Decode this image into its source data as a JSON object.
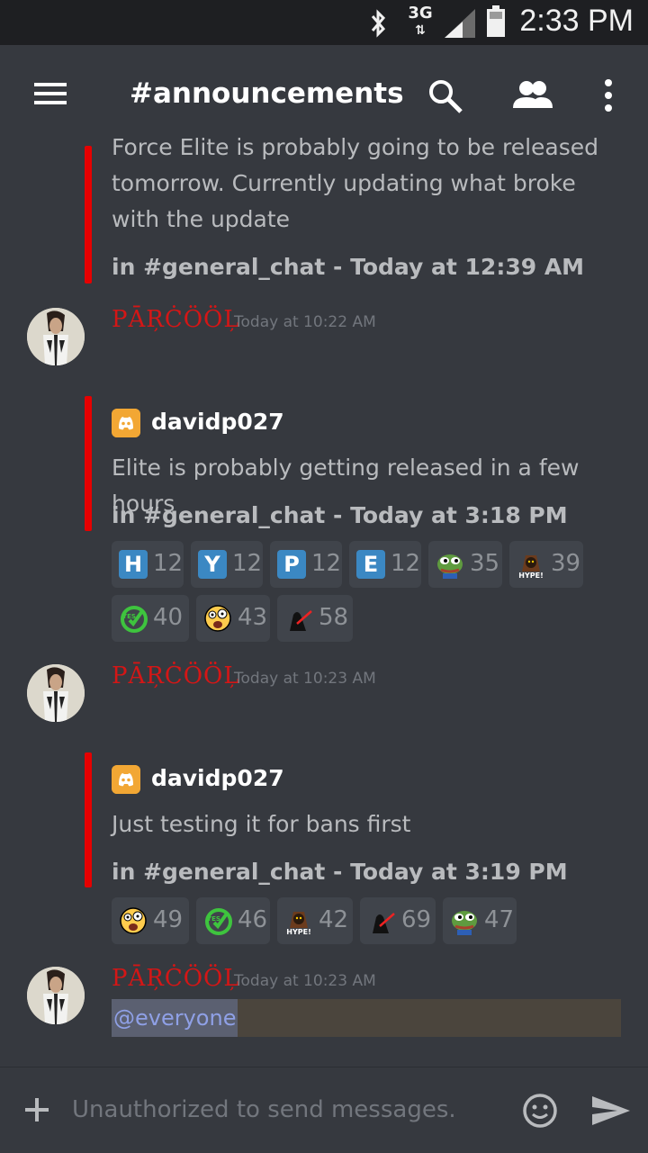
{
  "status_bar": {
    "time": "2:33 PM",
    "network": "3G"
  },
  "header": {
    "title": "#announcements"
  },
  "messages": [
    {
      "type": "embed-only",
      "embed_text": "Force Elite is probably going to be released tomorrow. Currently updating what broke with the update",
      "embed_meta": "in #general_chat - Today at 12:39 AM"
    },
    {
      "author": "PĀŖĊÖÖĻ",
      "timestamp": "Today at 10:22 AM",
      "embed": {
        "author": "davidp027",
        "text": "Elite is probably getting released in a few hours",
        "meta": "in #general_chat - Today at 3:18 PM"
      },
      "reactions": [
        {
          "emoji": "H",
          "kind": "letter",
          "count": "12"
        },
        {
          "emoji": "Y",
          "kind": "letter",
          "count": "12"
        },
        {
          "emoji": "P",
          "kind": "letter",
          "count": "12"
        },
        {
          "emoji": "E",
          "kind": "letter",
          "count": "12"
        },
        {
          "emoji": "pepe-emoji",
          "kind": "pepe",
          "count": "35"
        },
        {
          "emoji": "hype-emoji",
          "kind": "hype",
          "count": "39"
        },
        {
          "emoji": "yes-emoji",
          "kind": "yes",
          "count": "40"
        },
        {
          "emoji": "shocked-face-emoji",
          "kind": "face",
          "count": "43"
        },
        {
          "emoji": "vader-emoji",
          "kind": "vader",
          "count": "58"
        }
      ]
    },
    {
      "author": "PĀŖĊÖÖĻ",
      "timestamp": "Today at 10:23 AM",
      "embed": {
        "author": "davidp027",
        "text": "Just testing it for bans first",
        "meta": "in #general_chat - Today at 3:19 PM"
      },
      "reactions": [
        {
          "emoji": "shocked-face-emoji",
          "kind": "face",
          "count": "49"
        },
        {
          "emoji": "yes-emoji",
          "kind": "yes",
          "count": "46"
        },
        {
          "emoji": "hype-emoji",
          "kind": "hype",
          "count": "42"
        },
        {
          "emoji": "vader-emoji",
          "kind": "vader",
          "count": "69"
        },
        {
          "emoji": "pepe-emoji",
          "kind": "pepe",
          "count": "47"
        }
      ]
    },
    {
      "author": "PĀŖĊÖÖĻ",
      "timestamp": "Today at 10:23 AM",
      "mention": "@everyone"
    }
  ],
  "composer": {
    "placeholder": "Unauthorized to send messages."
  },
  "colors": {
    "background": "#36393f",
    "accent_red": "#e60000",
    "username": "#d41616",
    "mention": "#8fa0e6"
  }
}
